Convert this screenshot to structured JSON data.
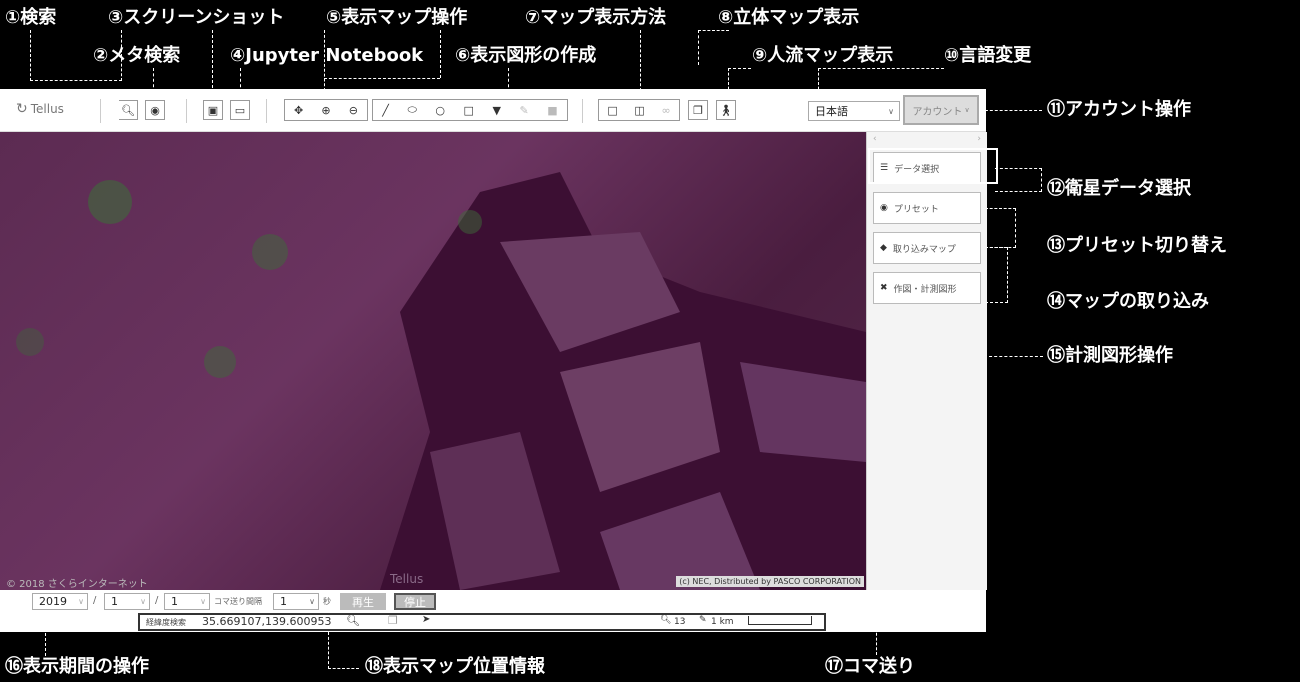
{
  "annotations": {
    "a1": "①検索",
    "a2": "②メタ検索",
    "a3": "③スクリーンショット",
    "a4": "④Jupyter Notebook",
    "a5": "⑤表示マップ操作",
    "a6": "⑥表示図形の作成",
    "a7": "⑦マップ表示方法",
    "a8": "⑧立体マップ表示",
    "a9": "⑨人流マップ表示",
    "a10": "⑩言語変更",
    "a11": "⑪アカウント操作",
    "a12": "⑫衛星データ選択",
    "a13": "⑬プリセット切り替え",
    "a14": "⑭マップの取り込み",
    "a15": "⑮計測図形操作",
    "a16": "⑯表示期間の操作",
    "a17": "⑰コマ送り",
    "a18": "⑱表示マップ位置情報"
  },
  "toolbar": {
    "logo": "Tellus",
    "language": "日本語",
    "account": "アカウント"
  },
  "sidebar": {
    "data_select": "データ選択",
    "preset": "プリセット",
    "import_map": "取り込みマップ",
    "draw_measure": "作図・計測図形"
  },
  "map": {
    "credit_left": "© 2018 さくらインターネット",
    "credit_right": "(c) NEC, Distributed by PASCO CORPORATION",
    "watermark": "Tellus"
  },
  "period": {
    "year": "2019",
    "month": "1",
    "day": "1",
    "interval_label": "コマ送り間隔",
    "interval": "1",
    "unit": "秒",
    "play": "再生",
    "stop": "停止"
  },
  "position": {
    "label": "経緯度検索",
    "coords": "35.669107,139.600953",
    "zoom": "13",
    "scale": "1 km"
  }
}
